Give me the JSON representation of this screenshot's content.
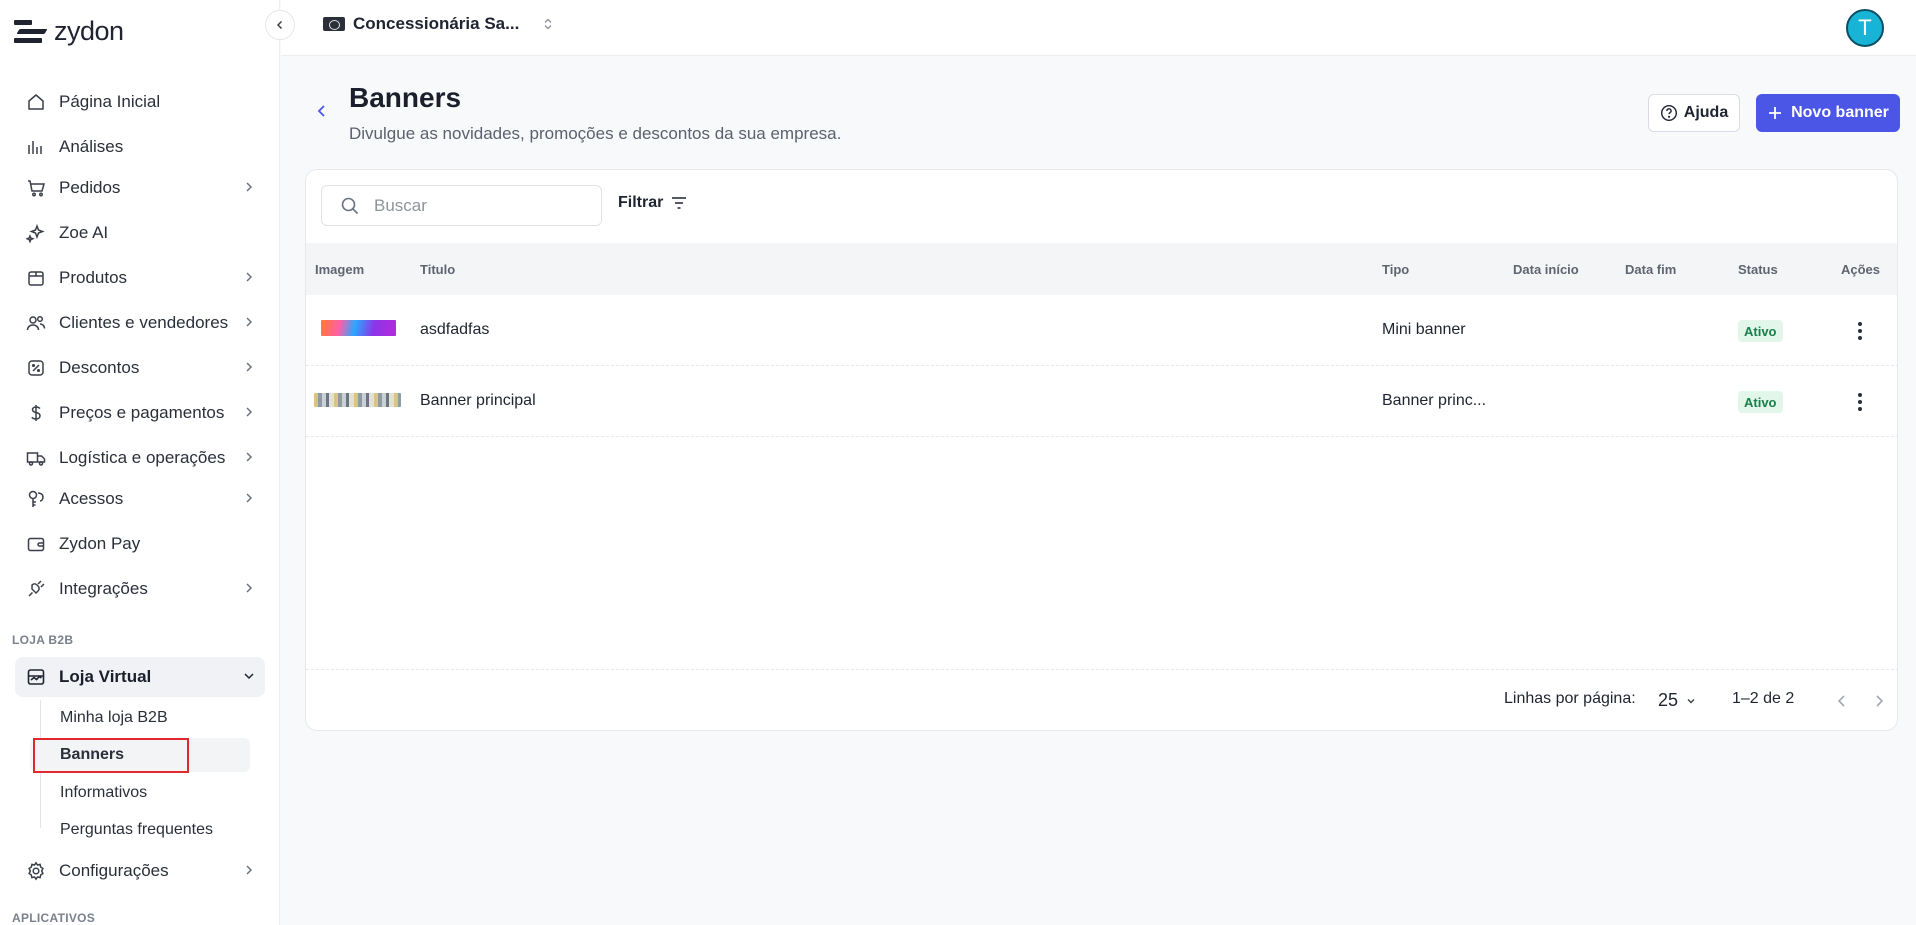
{
  "brand": {
    "name": "zydon"
  },
  "topbar": {
    "store_name": "Concessionária Sa...",
    "avatar_initial": "T"
  },
  "sidebar": {
    "items": [
      {
        "label": "Página Inicial"
      },
      {
        "label": "Análises"
      },
      {
        "label": "Pedidos"
      },
      {
        "label": "Zoe AI"
      },
      {
        "label": "Produtos"
      },
      {
        "label": "Clientes e vendedores"
      },
      {
        "label": "Descontos"
      },
      {
        "label": "Preços e pagamentos"
      },
      {
        "label": "Logística e operações"
      },
      {
        "label": "Acessos"
      },
      {
        "label": "Zydon Pay"
      },
      {
        "label": "Integrações"
      }
    ],
    "section_b2b": "LOJA B2B",
    "loja_virtual": {
      "label": "Loja Virtual",
      "children": [
        {
          "label": "Minha loja B2B"
        },
        {
          "label": "Banners"
        },
        {
          "label": "Informativos"
        },
        {
          "label": "Perguntas frequentes"
        }
      ]
    },
    "configuracoes": "Configurações",
    "section_apps": "APLICATIVOS"
  },
  "page": {
    "title": "Banners",
    "subtitle": "Divulgue as novidades, promoções e descontos da sua empresa.",
    "help_label": "Ajuda",
    "new_label": "Novo banner"
  },
  "toolbar": {
    "search_placeholder": "Buscar",
    "filter_label": "Filtrar"
  },
  "table": {
    "headers": [
      "Imagem",
      "Titulo",
      "Tipo",
      "Data início",
      "Data fim",
      "Status",
      "Ações"
    ],
    "rows": [
      {
        "title": "asdfadfas",
        "type": "Mini banner",
        "start": "",
        "end": "",
        "status": "Ativo"
      },
      {
        "title": "Banner principal",
        "type": "Banner princ...",
        "start": "",
        "end": "",
        "status": "Ativo"
      }
    ]
  },
  "pagination": {
    "rows_label": "Linhas por página:",
    "rows_value": "25",
    "range": "1–2 de 2"
  },
  "colors": {
    "accent": "#4b55e6",
    "status_active_bg": "#e2f6ea",
    "status_active_text": "#16824a",
    "highlight": "#e0282e"
  }
}
